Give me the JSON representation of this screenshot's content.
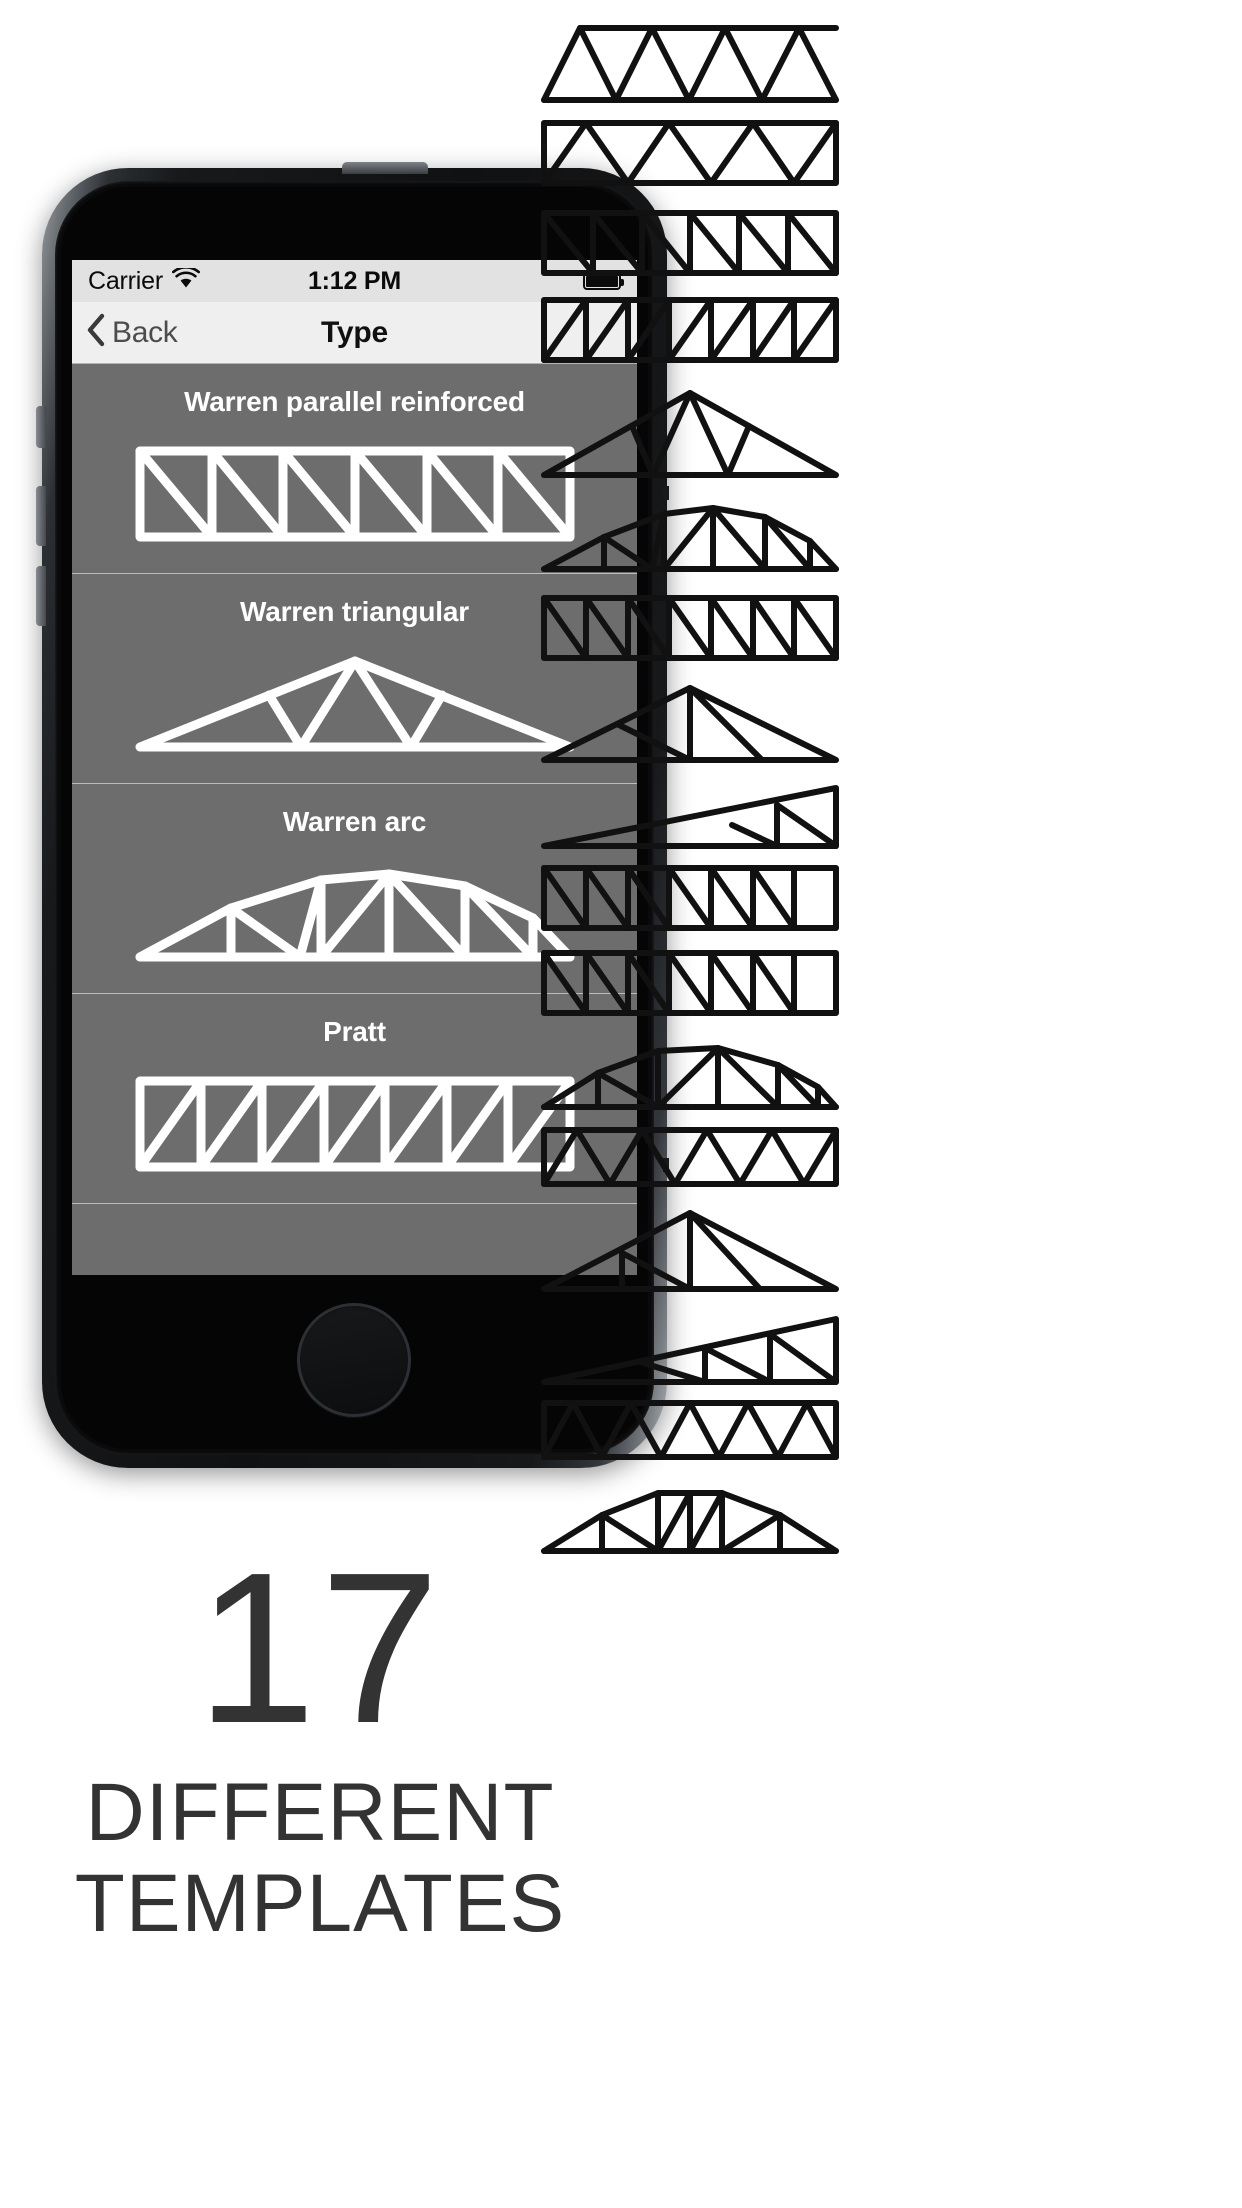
{
  "phone": {
    "device_name": "iphone-5s-space-gray",
    "hardware": {
      "earpiece": "earpiece-speaker",
      "front_camera": "front-camera",
      "home_button": "home-button",
      "power_button": "power-button",
      "silent_switch": "silent-switch",
      "volume_up": "volume-up-button",
      "volume_down": "volume-down-button"
    }
  },
  "status_bar": {
    "carrier": "Carrier",
    "wifi_icon": "wifi-icon",
    "time": "1:12 PM",
    "battery_icon": "battery-icon",
    "battery_level_pct": 92,
    "background": "#e2e2e2"
  },
  "nav_bar": {
    "back_label": "Back",
    "back_icon": "chevron-left-icon",
    "title": "Type",
    "background": "#efefef"
  },
  "list": {
    "background": "#6d6d6d",
    "separator_color": "#bcbcbc",
    "stroke_color": "#ffffff",
    "rows": [
      {
        "title": "Warren parallel reinforced",
        "figure": "warren-parallel-reinforced-truss"
      },
      {
        "title": "Warren triangular",
        "figure": "warren-triangular-truss"
      },
      {
        "title": "Warren arc",
        "figure": "warren-arc-truss"
      },
      {
        "title": "Pratt",
        "figure": "pratt-truss"
      }
    ]
  },
  "promo": {
    "number": "17",
    "line1": "DIFFERENT",
    "line2": "TEMPLATES",
    "color": "#333333"
  },
  "gallery": {
    "stroke_color": "#111111",
    "count": 17,
    "items": [
      {
        "name": "warren-truss",
        "type": "parallel-warren"
      },
      {
        "name": "warren-parallel-alt-truss",
        "type": "parallel-warren-verticals"
      },
      {
        "name": "warren-parallel-reinforced-truss",
        "type": "parallel-warren-reinforced"
      },
      {
        "name": "pratt-truss",
        "type": "parallel-pratt"
      },
      {
        "name": "warren-triangular-truss",
        "type": "triangular-warren"
      },
      {
        "name": "warren-arc-truss",
        "type": "arc-warren"
      },
      {
        "name": "howe-truss",
        "type": "parallel-howe"
      },
      {
        "name": "king-post-triangular-truss",
        "type": "triangular-kingpost"
      },
      {
        "name": "lean-to-truss",
        "type": "sloped-leanto"
      },
      {
        "name": "pratt-parallel-truss",
        "type": "parallel-pratt-verticals"
      },
      {
        "name": "howe-parallel-truss",
        "type": "parallel-howe-verticals"
      },
      {
        "name": "bowstring-arc-truss",
        "type": "arc-bowstring"
      },
      {
        "name": "warren-parallel-dense-truss",
        "type": "parallel-warren-dense"
      },
      {
        "name": "queen-post-triangular-truss",
        "type": "triangular-queenpost"
      },
      {
        "name": "sloped-lean-to-long-truss",
        "type": "sloped-leanto-long"
      },
      {
        "name": "warren-parallel-zigzag-truss",
        "type": "parallel-warren-zigzag"
      },
      {
        "name": "camelback-arc-truss",
        "type": "arc-camelback"
      }
    ]
  }
}
